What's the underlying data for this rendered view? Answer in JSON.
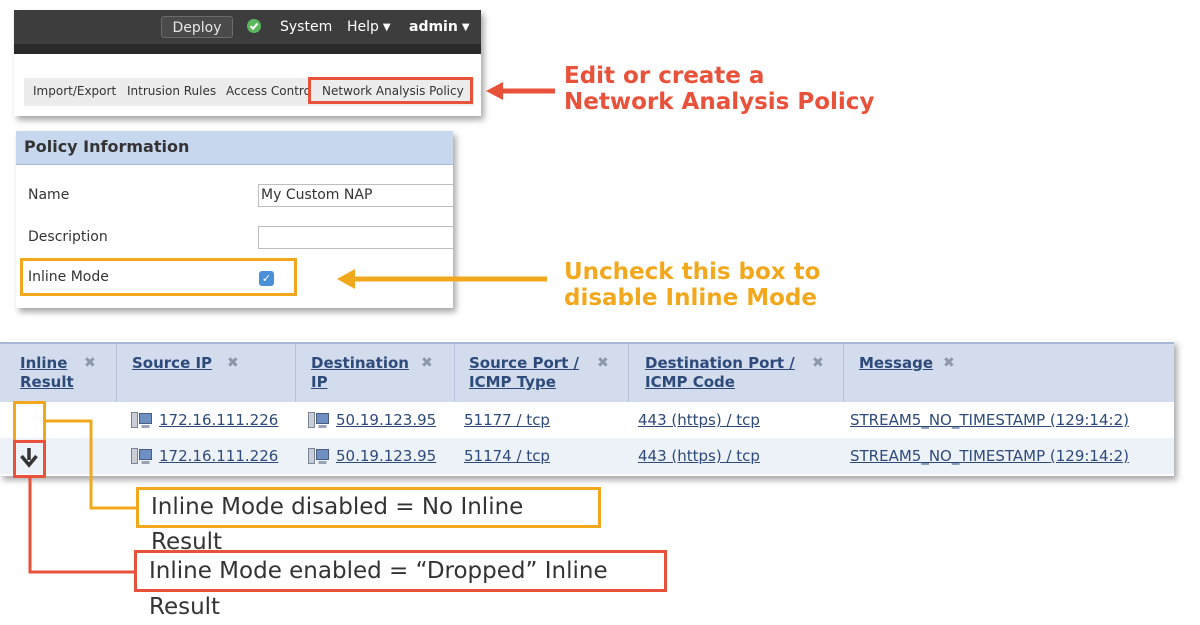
{
  "topbar": {
    "deploy_label": "Deploy",
    "system_label": "System",
    "help_label": "Help",
    "user_label": "admin",
    "status_color": "#5cb85c"
  },
  "subnav": {
    "items": [
      "Import/Export",
      "Intrusion Rules",
      "Access Contro",
      "Network Analysis Policy"
    ]
  },
  "policy": {
    "title": "Policy Information",
    "name_label": "Name",
    "name_value": "My Custom NAP",
    "description_label": "Description",
    "description_value": "",
    "inline_mode_label": "Inline Mode",
    "inline_mode_checked": true
  },
  "table": {
    "columns": [
      {
        "line1": "Inline",
        "line2": "Result"
      },
      {
        "line1": "Source IP",
        "line2": ""
      },
      {
        "line1": "Destination",
        "line2": "IP"
      },
      {
        "line1": "Source Port /",
        "line2": "ICMP Type"
      },
      {
        "line1": "Destination Port /",
        "line2": "ICMP Code"
      },
      {
        "line1": "Message",
        "line2": ""
      }
    ],
    "rows": [
      {
        "inline_result": "",
        "source_ip": "172.16.111.226",
        "destination_ip": "50.19.123.95",
        "source_port": "51177 / tcp",
        "destination_port": "443 (https) / tcp",
        "message": "STREAM5_NO_TIMESTAMP (129:14:2)"
      },
      {
        "inline_result": "dropped",
        "source_ip": "172.16.111.226",
        "destination_ip": "50.19.123.95",
        "source_port": "51174 / tcp",
        "destination_port": "443 (https) / tcp",
        "message": "STREAM5_NO_TIMESTAMP (129:14:2)"
      }
    ]
  },
  "callouts": {
    "nap_line1": "Edit or create a",
    "nap_line2": "Network Analysis Policy",
    "uncheck_line1": "Uncheck this box to",
    "uncheck_line2": "disable Inline Mode",
    "disabled_note": "Inline Mode disabled = No Inline Result",
    "enabled_note": "Inline Mode enabled = “Dropped” Inline Result"
  },
  "colors": {
    "red": "#e8513a",
    "orange": "#f2a81d",
    "link": "#2d4a7a",
    "header_bg": "#d3dcec"
  }
}
